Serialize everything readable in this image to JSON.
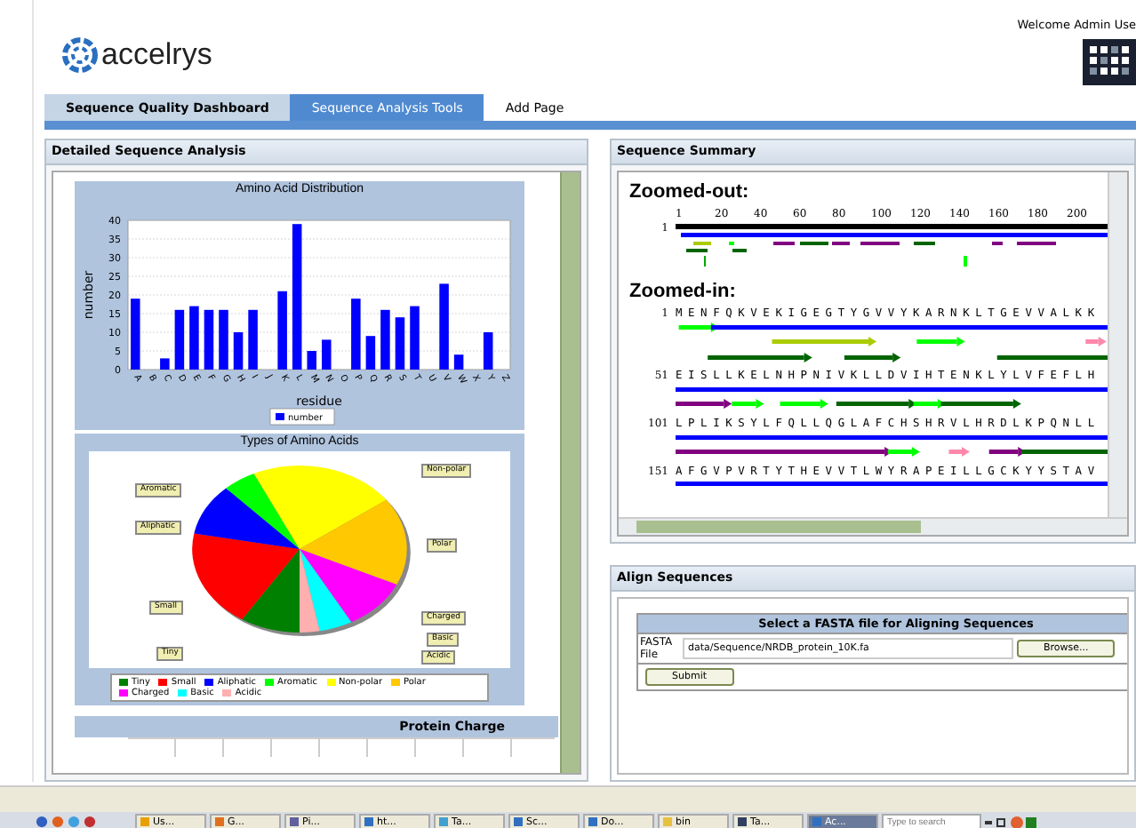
{
  "header": {
    "logo": "accelrys",
    "welcome": "Welcome Admin Use"
  },
  "tabs": [
    {
      "label": "Sequence Quality Dashboard",
      "selected": false
    },
    {
      "label": "Sequence Analysis Tools",
      "selected": true
    },
    {
      "label": "Add Page",
      "selected": false
    }
  ],
  "left_panel": {
    "title": "Detailed Sequence Analysis",
    "bar_chart": {
      "chart_data": {
        "type": "bar",
        "title": "Amino Acid Distribution",
        "xlabel": "residue",
        "ylabel": "number",
        "categories": [
          "A",
          "B",
          "C",
          "D",
          "E",
          "F",
          "G",
          "H",
          "I",
          "J",
          "K",
          "L",
          "M",
          "N",
          "O",
          "P",
          "Q",
          "R",
          "S",
          "T",
          "U",
          "V",
          "W",
          "X",
          "Y",
          "Z"
        ],
        "series": [
          {
            "name": "number",
            "color": "#0000ff",
            "values": [
              19,
              0,
              3,
              16,
              17,
              16,
              16,
              10,
              16,
              0,
              21,
              39,
              5,
              8,
              0,
              19,
              9,
              16,
              14,
              17,
              0,
              23,
              4,
              0,
              10,
              0
            ]
          }
        ],
        "ylim": [
          0,
          40
        ],
        "yticks": [
          0,
          5,
          10,
          15,
          20,
          25,
          30,
          35,
          40
        ],
        "grid": true
      }
    },
    "pie_chart": {
      "title": "Types of Amino Acids",
      "kind": "picture",
      "slice_labels": [
        "Non-polar",
        "Aromatic",
        "Aliphatic",
        "Polar",
        "Small",
        "Charged",
        "Basic",
        "Tiny",
        "Acidic"
      ],
      "legend": [
        {
          "label": "Tiny",
          "color": "#008000"
        },
        {
          "label": "Small",
          "color": "#ff0000"
        },
        {
          "label": "Aliphatic",
          "color": "#0000ff"
        },
        {
          "label": "Aromatic",
          "color": "#00ff00"
        },
        {
          "label": "Non-polar",
          "color": "#ffff00"
        },
        {
          "label": "Polar",
          "color": "#ffc800"
        },
        {
          "label": "Charged",
          "color": "#ff00ff"
        },
        {
          "label": "Basic",
          "color": "#00ffff"
        },
        {
          "label": "Acidic",
          "color": "#ffafaf"
        }
      ]
    },
    "protein_charge": {
      "title": "Protein Charge"
    }
  },
  "sequence_summary": {
    "title": "Sequence Summary",
    "zoomed_out": "Zoomed-out:",
    "overview_start": "1",
    "ruler_ticks": [
      "1",
      "20",
      "40",
      "60",
      "80",
      "100",
      "120",
      "140",
      "160",
      "180",
      "200"
    ],
    "zoomed_in": "Zoomed-in:",
    "rows": [
      {
        "start": "1",
        "sequence": "MENFQKVEKIGEGTYGVVYKARNKLTGEVVALKK"
      },
      {
        "start": "51",
        "sequence": "EISLLKELNHPNIVKLLDVIHTENKLYLVFEFLH"
      },
      {
        "start": "101",
        "sequence": "LPLIKSYLFQLLQGLAFCHSHRVLHRDLKPQNLL"
      },
      {
        "start": "151",
        "sequence": "AFGVPVRTYTHEVVTLWYRAPEILLGCKYYSTAV"
      }
    ]
  },
  "align_sequences": {
    "title": "Align Sequences",
    "form_title": "Select a FASTA file for Aligning Sequences",
    "field_label": "FASTA File",
    "file_value": "data/Sequence/NRDB_protein_10K.fa",
    "browse": "Browse...",
    "submit": "Submit"
  },
  "taskbar": {
    "items": [
      "Us...",
      "G...",
      "Pi...",
      "ht...",
      "Ta...",
      "Sc...",
      "Do...",
      "bin",
      "Ta...",
      "Ac..."
    ],
    "search_placeholder": "Type to search"
  }
}
